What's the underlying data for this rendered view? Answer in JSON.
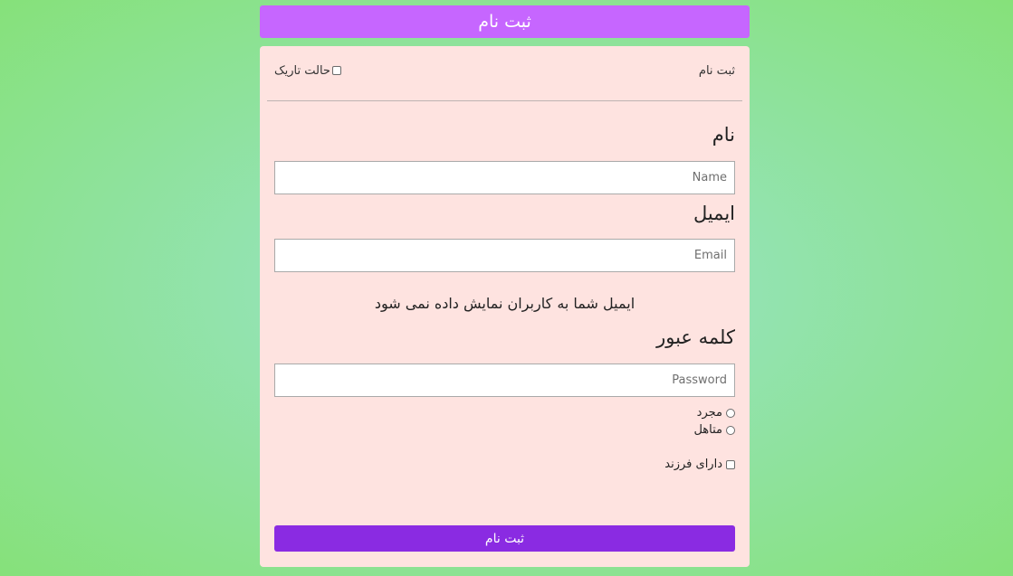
{
  "header": {
    "title": "ثبت نام"
  },
  "card": {
    "top_label": "ثبت نام",
    "dark_mode_label": "حالت تاریک",
    "name_label": "نام",
    "name_placeholder": "Name",
    "email_label": "ایمیل",
    "email_placeholder": "Email",
    "email_hint": "ایمیل شما به کاربران نمایش داده نمی شود",
    "password_label": "کلمه عبور",
    "password_placeholder": "Password",
    "marital_options": [
      "مجرد",
      "متاهل"
    ],
    "has_children_label": "دارای فرزند",
    "submit_label": "ثبت نام"
  },
  "colors": {
    "header_bg": "#c666ff",
    "card_bg": "#fee3e0",
    "button_bg": "#8a2be2"
  }
}
